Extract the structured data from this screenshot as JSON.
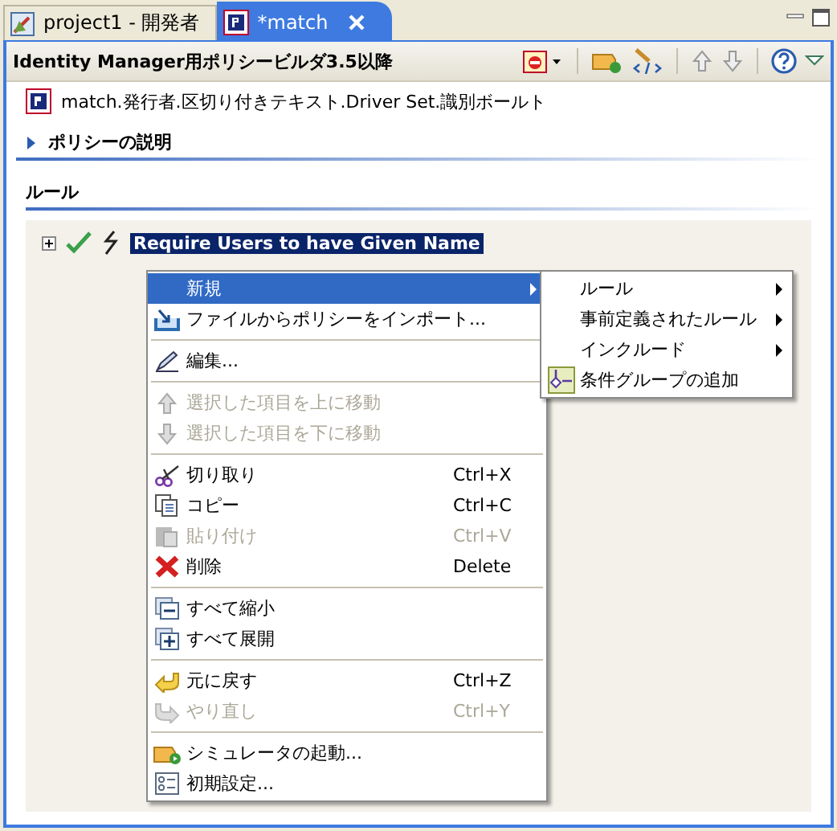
{
  "tabs": [
    {
      "label": "project1 - 開発者",
      "selected": false,
      "closable": false
    },
    {
      "label": "*match",
      "selected": true,
      "closable": true
    }
  ],
  "editor": {
    "title": "Identity Manager用ポリシービルダ3.5以降",
    "path": "match.発行者.区切り付きテキスト.Driver Set.識別ボールト",
    "description_section": {
      "label": "ポリシーの説明",
      "expanded": false
    },
    "rules_section": {
      "label": "ルール"
    },
    "rules": [
      {
        "name": "Require Users to have Given Name",
        "expanded": false,
        "enabled": true,
        "selected": true
      }
    ]
  },
  "context_menu": {
    "items": [
      {
        "kind": "item",
        "label": "新規",
        "selected": true,
        "disabled": false,
        "submenu": true
      },
      {
        "kind": "item",
        "label": "ファイルからポリシーをインポート...",
        "selected": false,
        "disabled": false,
        "submenu": false
      },
      {
        "kind": "separator"
      },
      {
        "kind": "item",
        "label": "編集...",
        "selected": false,
        "disabled": false,
        "submenu": false
      },
      {
        "kind": "separator"
      },
      {
        "kind": "item",
        "label": "選択した項目を上に移動",
        "selected": false,
        "disabled": true,
        "submenu": false
      },
      {
        "kind": "item",
        "label": "選択した項目を下に移動",
        "selected": false,
        "disabled": true,
        "submenu": false
      },
      {
        "kind": "separator"
      },
      {
        "kind": "item",
        "label": "切り取り",
        "shortcut": "Ctrl+X",
        "selected": false,
        "disabled": false,
        "submenu": false
      },
      {
        "kind": "item",
        "label": "コピー",
        "shortcut": "Ctrl+C",
        "selected": false,
        "disabled": false,
        "submenu": false
      },
      {
        "kind": "item",
        "label": "貼り付け",
        "shortcut": "Ctrl+V",
        "selected": false,
        "disabled": true,
        "submenu": false
      },
      {
        "kind": "item",
        "label": "削除",
        "shortcut": "Delete",
        "selected": false,
        "disabled": false,
        "submenu": false
      },
      {
        "kind": "separator"
      },
      {
        "kind": "item",
        "label": "すべて縮小",
        "selected": false,
        "disabled": false,
        "submenu": false
      },
      {
        "kind": "item",
        "label": "すべて展開",
        "selected": false,
        "disabled": false,
        "submenu": false
      },
      {
        "kind": "separator"
      },
      {
        "kind": "item",
        "label": "元に戻す",
        "shortcut": "Ctrl+Z",
        "selected": false,
        "disabled": false,
        "submenu": false
      },
      {
        "kind": "item",
        "label": "やり直し",
        "shortcut": "Ctrl+Y",
        "selected": false,
        "disabled": true,
        "submenu": false
      },
      {
        "kind": "separator"
      },
      {
        "kind": "item",
        "label": "シミュレータの起動...",
        "selected": false,
        "disabled": false,
        "submenu": false
      },
      {
        "kind": "item",
        "label": "初期設定...",
        "selected": false,
        "disabled": false,
        "submenu": false
      }
    ],
    "submenu": [
      {
        "label": "ルール",
        "submenu": true
      },
      {
        "label": "事前定義されたルール",
        "submenu": true
      },
      {
        "label": "インクルード",
        "submenu": true
      },
      {
        "label": "条件グループの追加",
        "submenu": false
      }
    ]
  }
}
